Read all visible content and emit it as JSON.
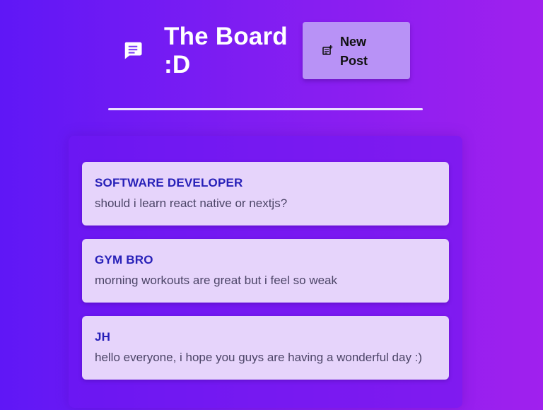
{
  "header": {
    "icon": "message-icon",
    "title": "The Board :D",
    "new_post": {
      "icon": "new-post-icon",
      "label": "New Post"
    }
  },
  "posts": [
    {
      "author": "SOFTWARE DEVELOPER",
      "body": "should i learn react native or nextjs?"
    },
    {
      "author": "GYM BRO",
      "body": "morning workouts are great but i feel so weak"
    },
    {
      "author": "JH",
      "body": "hello everyone, i hope you guys are having a wonderful day :)"
    }
  ],
  "colors": {
    "background_start": "#5f17f6",
    "background_end": "#a020ee",
    "button": "#b892f6",
    "card": "#e6d4fb",
    "author": "#2720b8",
    "body_text": "#4b4466"
  }
}
